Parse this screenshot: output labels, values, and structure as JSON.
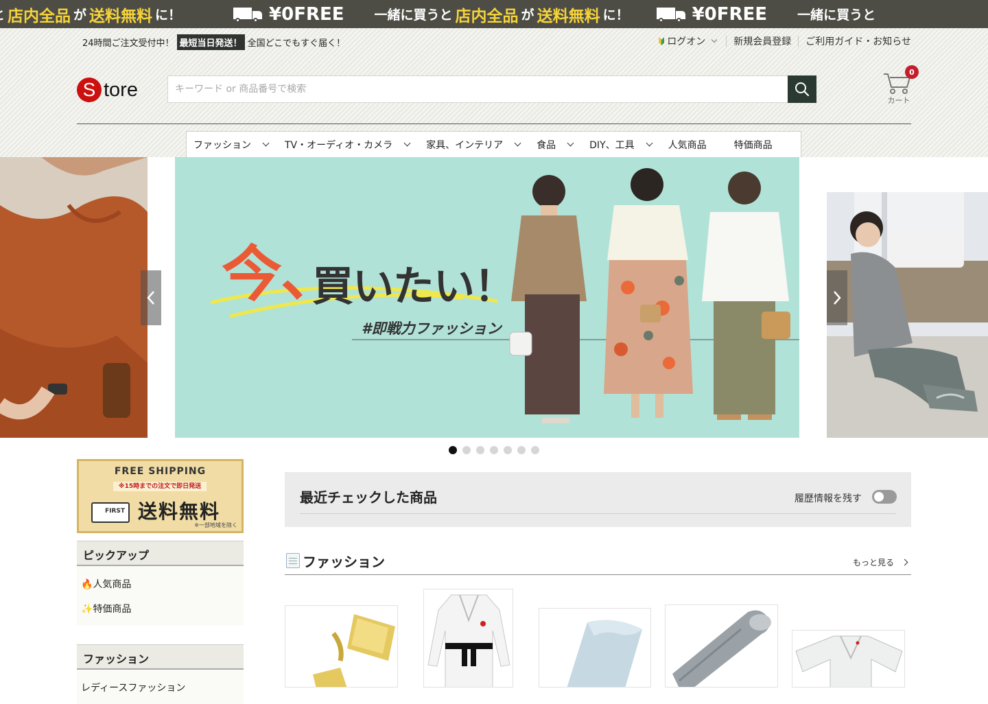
{
  "promo": {
    "seg_lead": "と",
    "seg_w1": "一緒に買うと",
    "seg_y1": "店内全品",
    "seg_w2": "が",
    "seg_y2": "送料無料",
    "seg_w3": "に！",
    "free_text": "¥0FREE",
    "truck_icon": "truck-icon"
  },
  "topbar": {
    "left_text1": "24時間ご注文受付中！",
    "highlight": "最短当日発送！",
    "left_text2": "全国どこでもすぐ届く！",
    "login": "ログオン",
    "register": "新規会員登録",
    "guide": "ご利用ガイド・お知らせ"
  },
  "logo": {
    "s": "S",
    "rest": "tore",
    "color": "#cc0f0f"
  },
  "search": {
    "placeholder": "キーワード or 商品番号で検索",
    "value": "",
    "icon": "search-icon"
  },
  "cart": {
    "label": "カート",
    "count": "0",
    "icon": "cart-icon"
  },
  "nav": {
    "items": [
      {
        "label": "ファッション",
        "dropdown": true
      },
      {
        "label": "TV・オーディオ・カメラ",
        "dropdown": true
      },
      {
        "label": "家具、インテリア",
        "dropdown": true
      },
      {
        "label": "食品",
        "dropdown": true
      },
      {
        "label": "DIY、工具",
        "dropdown": true
      },
      {
        "label": "人気商品",
        "dropdown": false
      },
      {
        "label": "特価商品",
        "dropdown": false
      }
    ]
  },
  "banner": {
    "headline_a": "今、",
    "headline_b": "買いたい！",
    "hashtag": "#即戦力ファッション",
    "slide_count": 7,
    "active_slide": 1,
    "bg_color": "#b1e2d8"
  },
  "shipping_card": {
    "title": "FREE SHIPPING",
    "note": "※15時までの注文で即日発送",
    "big": "送料無料",
    "truck_text": "FIRST",
    "small": "※一部地域を除く"
  },
  "sidebar": {
    "pickup_title": "ピックアップ",
    "pickup_items": [
      {
        "icon": "🔥",
        "label": "人気商品"
      },
      {
        "icon": "✨",
        "label": "特価商品"
      }
    ],
    "fashion_title": "ファッション",
    "fashion_items": [
      {
        "label": "レディースファッション"
      }
    ]
  },
  "recent": {
    "title": "最近チェックした商品",
    "toggle_label": "履歴情報を残す",
    "toggle_on": false
  },
  "section": {
    "title": "ファッション",
    "more": "もっと見る"
  }
}
